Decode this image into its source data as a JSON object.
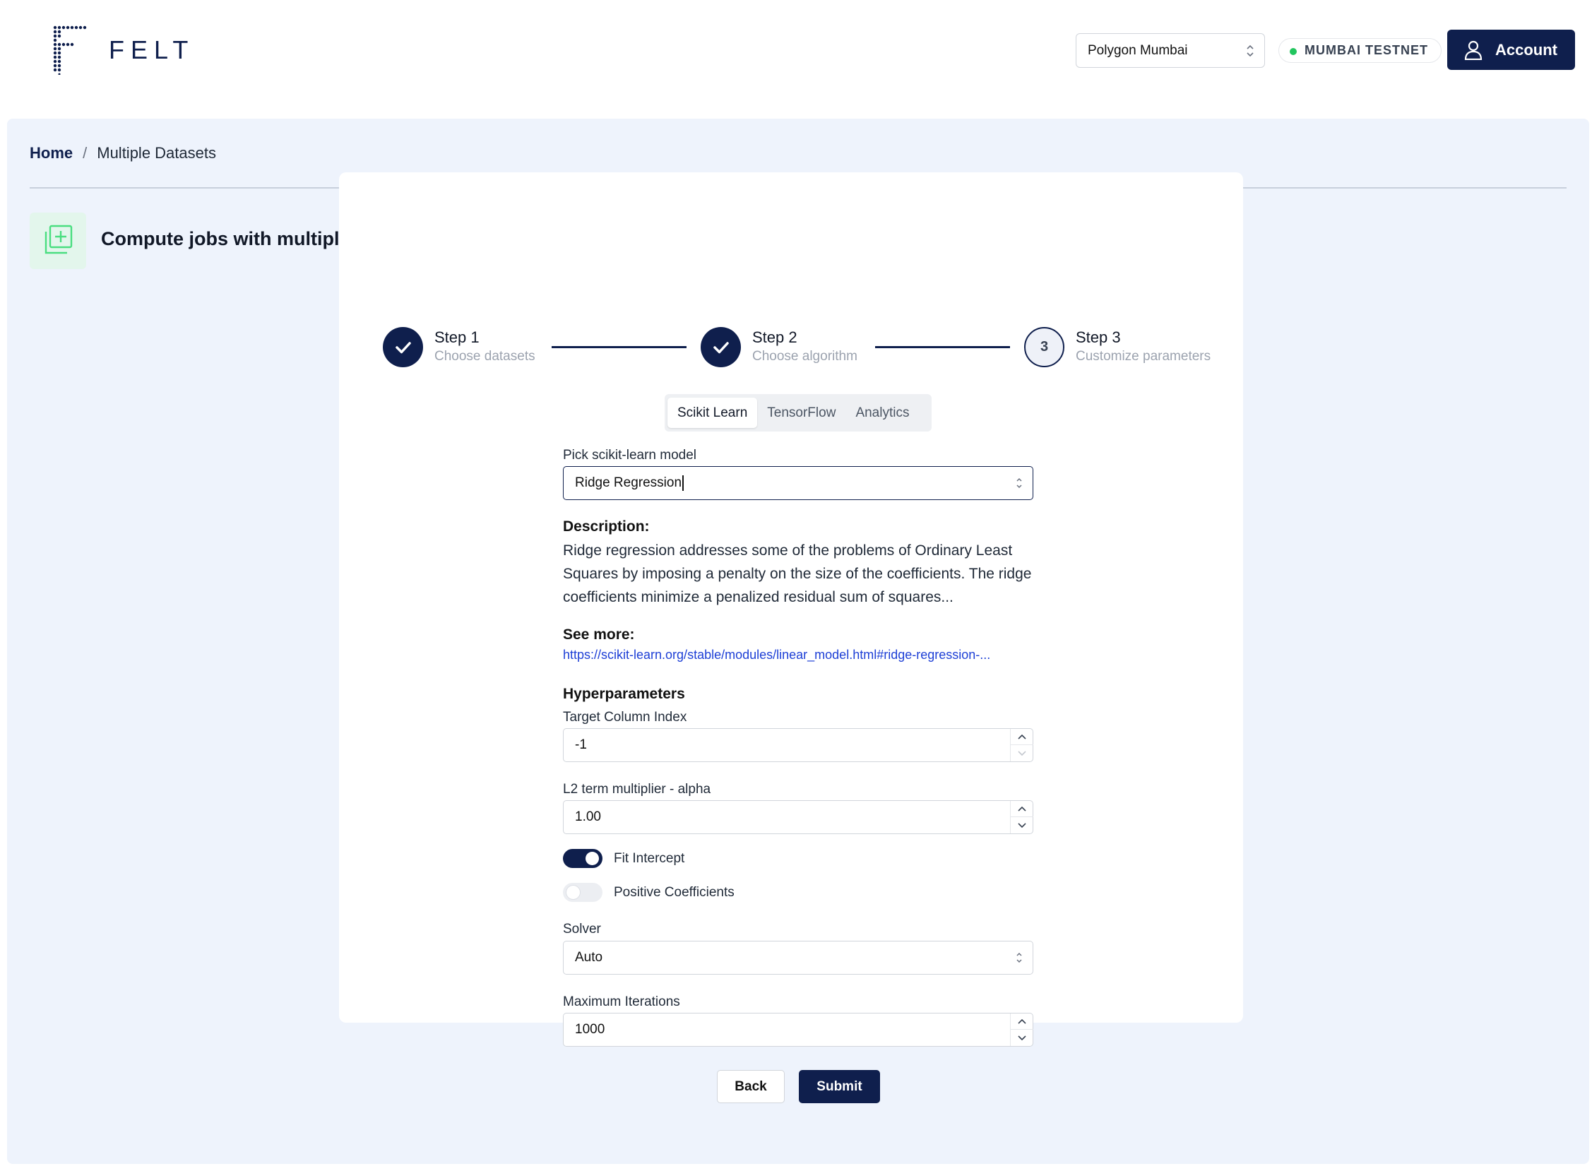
{
  "header": {
    "logo_text": "FELT",
    "network_select": "Polygon Mumbai",
    "network_badge": "MUMBAI TESTNET",
    "account_label": "Account"
  },
  "breadcrumb": {
    "home": "Home",
    "separator": "/",
    "current": "Multiple Datasets"
  },
  "page": {
    "title": "Compute jobs with multiple datasets"
  },
  "stepper": {
    "steps": [
      {
        "title": "Step 1",
        "subtitle": "Choose datasets",
        "status": "complete"
      },
      {
        "title": "Step 2",
        "subtitle": "Choose algorithm",
        "status": "complete"
      },
      {
        "title": "Step 3",
        "subtitle": "Customize parameters",
        "status": "current",
        "number": "3"
      }
    ]
  },
  "tabs": {
    "items": [
      "Scikit Learn",
      "TensorFlow",
      "Analytics"
    ],
    "active": "Scikit Learn"
  },
  "form": {
    "model_label": "Pick scikit-learn model",
    "model_value": "Ridge Regression",
    "description_label": "Description:",
    "description_text": "Ridge regression addresses some of the problems of Ordinary Least Squares by imposing a penalty on the size of the coefficients. The ridge coefficients minimize a penalized residual sum of squares...",
    "see_more_label": "See more:",
    "see_more_link": "https://scikit-learn.org/stable/modules/linear_model.html#ridge-regression-...",
    "hyperparameters_label": "Hyperparameters",
    "target_column_label": "Target Column Index",
    "target_column_value": "-1",
    "alpha_label": "L2 term multiplier - alpha",
    "alpha_value": "1.00",
    "fit_intercept_label": "Fit Intercept",
    "fit_intercept_on": true,
    "positive_label": "Positive Coefficients",
    "positive_on": false,
    "solver_label": "Solver",
    "solver_value": "Auto",
    "max_iter_label": "Maximum Iterations",
    "max_iter_value": "1000"
  },
  "actions": {
    "back": "Back",
    "submit": "Submit"
  },
  "colors": {
    "primary": "#0f1f4d",
    "background_panel": "#eef3fc",
    "badge_dot": "#22c55e",
    "link": "#1d3fd6",
    "icon_green": "#4ade80"
  }
}
